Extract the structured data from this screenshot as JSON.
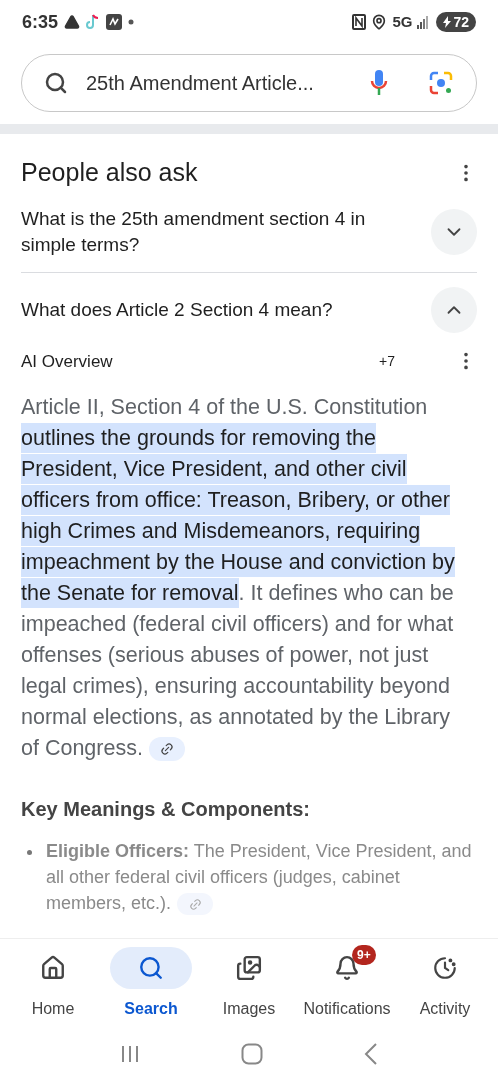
{
  "status_bar": {
    "time": "6:35",
    "network": "5G",
    "battery": "72"
  },
  "search": {
    "value": "25th Amendment Article..."
  },
  "people_also_ask": {
    "title": "People also ask",
    "questions": [
      {
        "text": "What is the 25th amendment section 4 in simple terms?",
        "expanded": false
      },
      {
        "text": "What does Article 2 Section 4 mean?",
        "expanded": true
      }
    ]
  },
  "ai_overview": {
    "label": "AI Overview",
    "sources": "+7",
    "paragraph": [
      {
        "text": "Article II, Section 4 of the U.S. Constitution ",
        "highlighted": false
      },
      {
        "text": "outlines the grounds for removing the President, Vice President, and other civil officers from office: Treason, Bribery, or other high Crimes and Misdemeanors, requiring impeachment by the House and conviction by the Senate for removal",
        "highlighted": true
      },
      {
        "text": ". It defines who can be impeached (federal civil officers) and for what offenses (serious abuses of power, not just legal crimes), ensuring accountability beyond normal elections, as annotated by the Library of Congress.",
        "highlighted": false
      }
    ],
    "heading": "Key Meanings & Components:",
    "bullets": [
      {
        "text": "**Eligible Officers:** The President, Vice President, and all other federal civil officers (judges, cabinet members, etc.)."
      }
    ]
  },
  "bottom_nav": [
    {
      "label": "Home",
      "selected": false
    },
    {
      "label": "Search",
      "selected": true
    },
    {
      "label": "Images",
      "selected": false
    },
    {
      "label": "Notifications",
      "selected": false,
      "badge": "9+"
    },
    {
      "label": "Activity",
      "selected": false
    }
  ]
}
